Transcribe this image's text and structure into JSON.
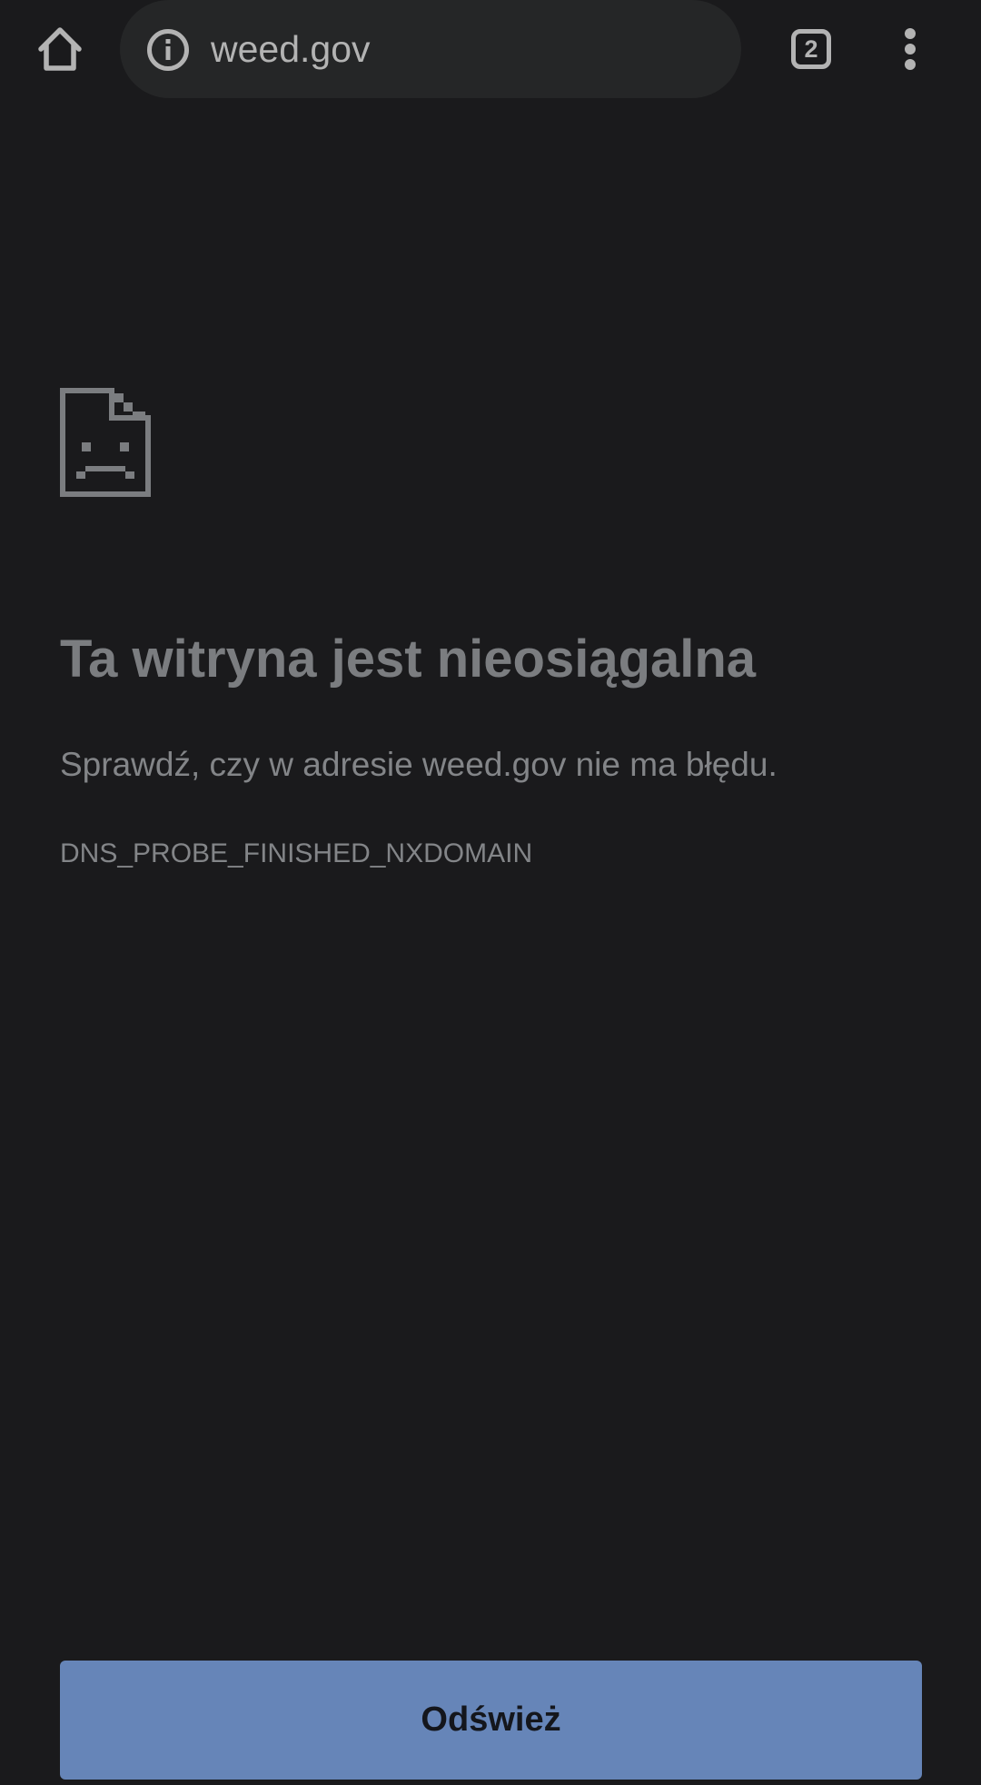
{
  "toolbar": {
    "home_icon": "home-icon",
    "omnibox": {
      "security_icon": "info-icon",
      "url": "weed.gov"
    },
    "tab_count": "2",
    "menu_icon": "more-vert-icon"
  },
  "error_page": {
    "icon": "sad-page-icon",
    "headline": "Ta witryna jest nieosiągalna",
    "suggestion": "Sprawdź, czy w adresie weed.gov nie ma błędu.",
    "error_code": "DNS_PROBE_FINISHED_NXDOMAIN",
    "reload_label": "Odśwież"
  },
  "colors": {
    "background": "#1a1a1c",
    "omnibox": "#252627",
    "toolbar_icons": "#b3b3b3",
    "text": "#7b7d80",
    "button": "#6685b8",
    "button_text": "#14161c"
  }
}
